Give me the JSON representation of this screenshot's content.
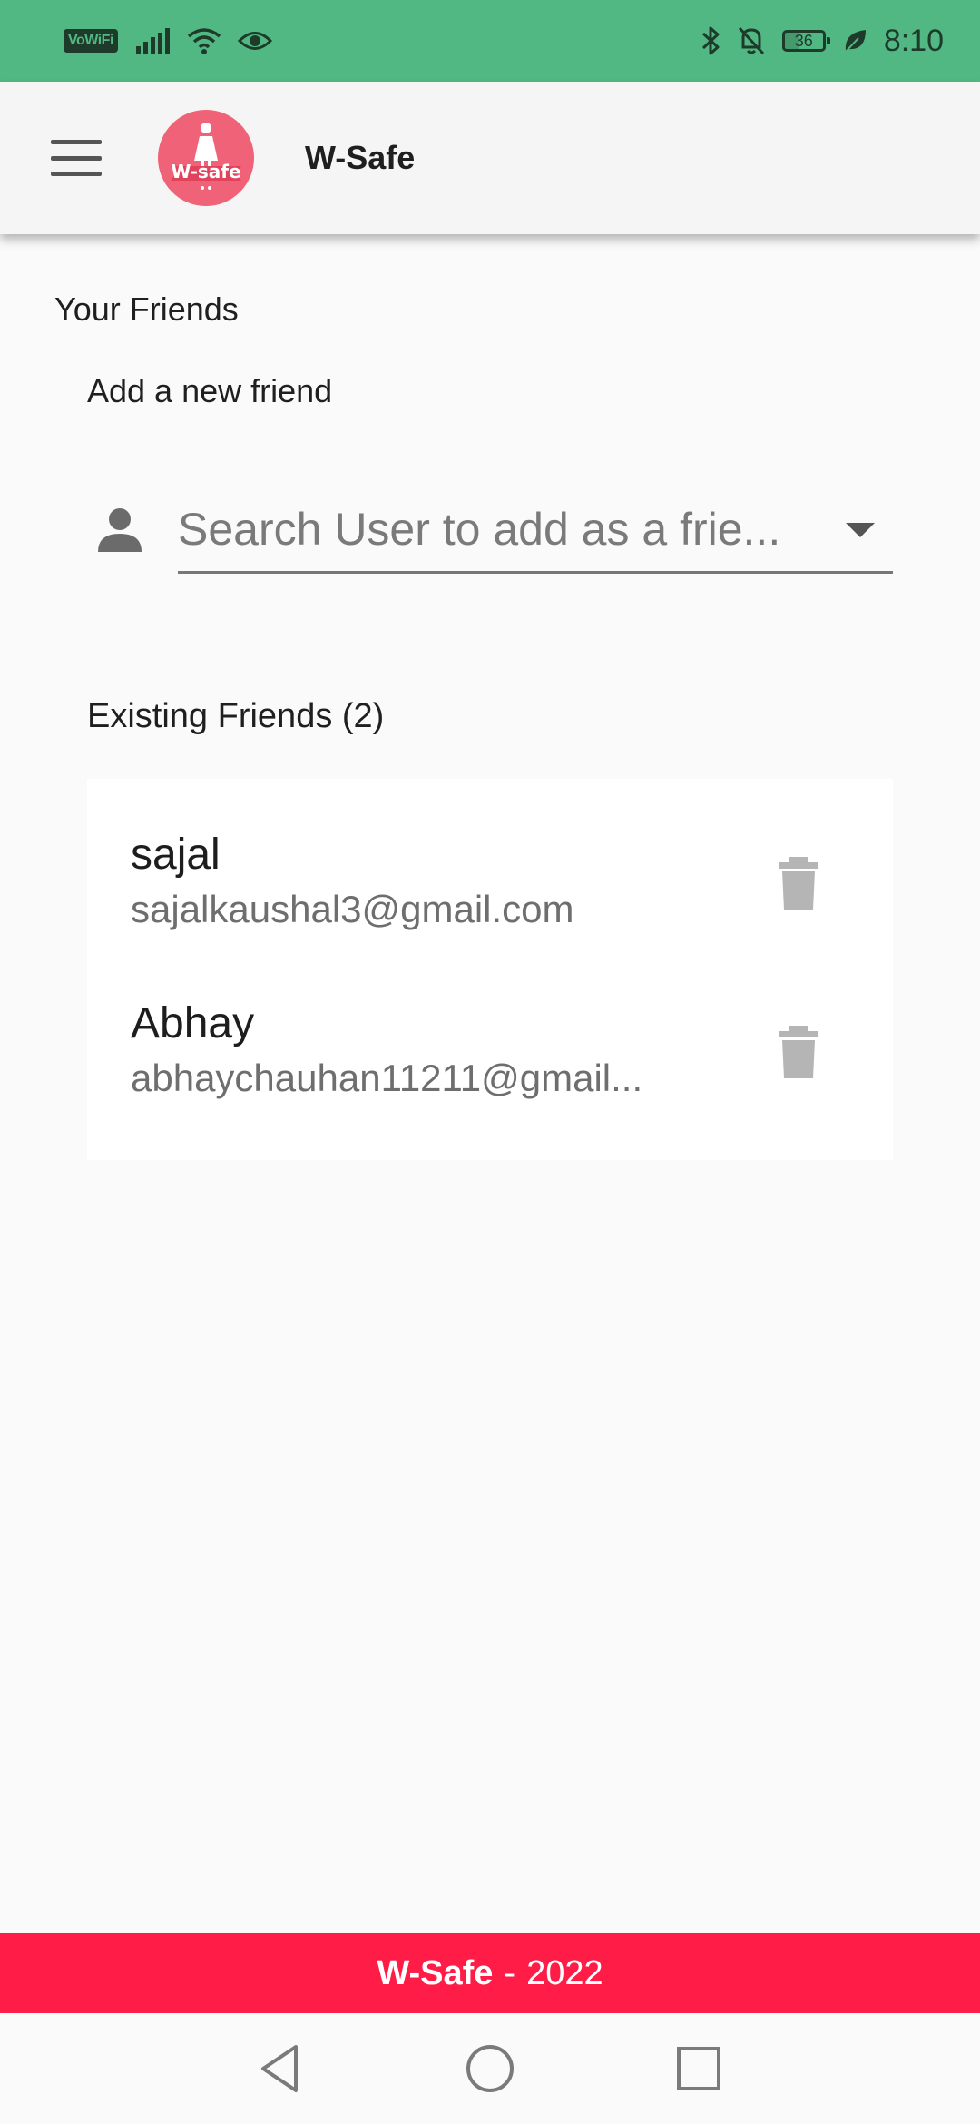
{
  "status_bar": {
    "vowifi_label": "VoWiFi",
    "battery_level": "36",
    "time": "8:10",
    "icons": [
      "signal-icon",
      "wifi-icon",
      "eye-icon",
      "bluetooth-icon",
      "bell-off-icon",
      "battery-icon",
      "leaf-icon"
    ]
  },
  "app_bar": {
    "title": "W-Safe",
    "logo_text": "W-safe",
    "menu_icon": "menu-icon"
  },
  "page": {
    "section_title": "Your Friends",
    "add_title": "Add a new friend",
    "search_placeholder": "Search User to add as a frie...",
    "existing_title": "Existing Friends (2)",
    "friends": [
      {
        "name": "sajal",
        "email": "sajalkaushal3@gmail.com"
      },
      {
        "name": "Abhay",
        "email": "abhaychauhan11211@gmail..."
      }
    ]
  },
  "footer": {
    "brand": "W-Safe",
    "separator": "-",
    "year": "2022"
  },
  "colors": {
    "status_bar": "#52b883",
    "footer": "#ff1d47",
    "logo": "#f06277",
    "app_bar": "#f5f5f5",
    "background": "#fafafa"
  }
}
